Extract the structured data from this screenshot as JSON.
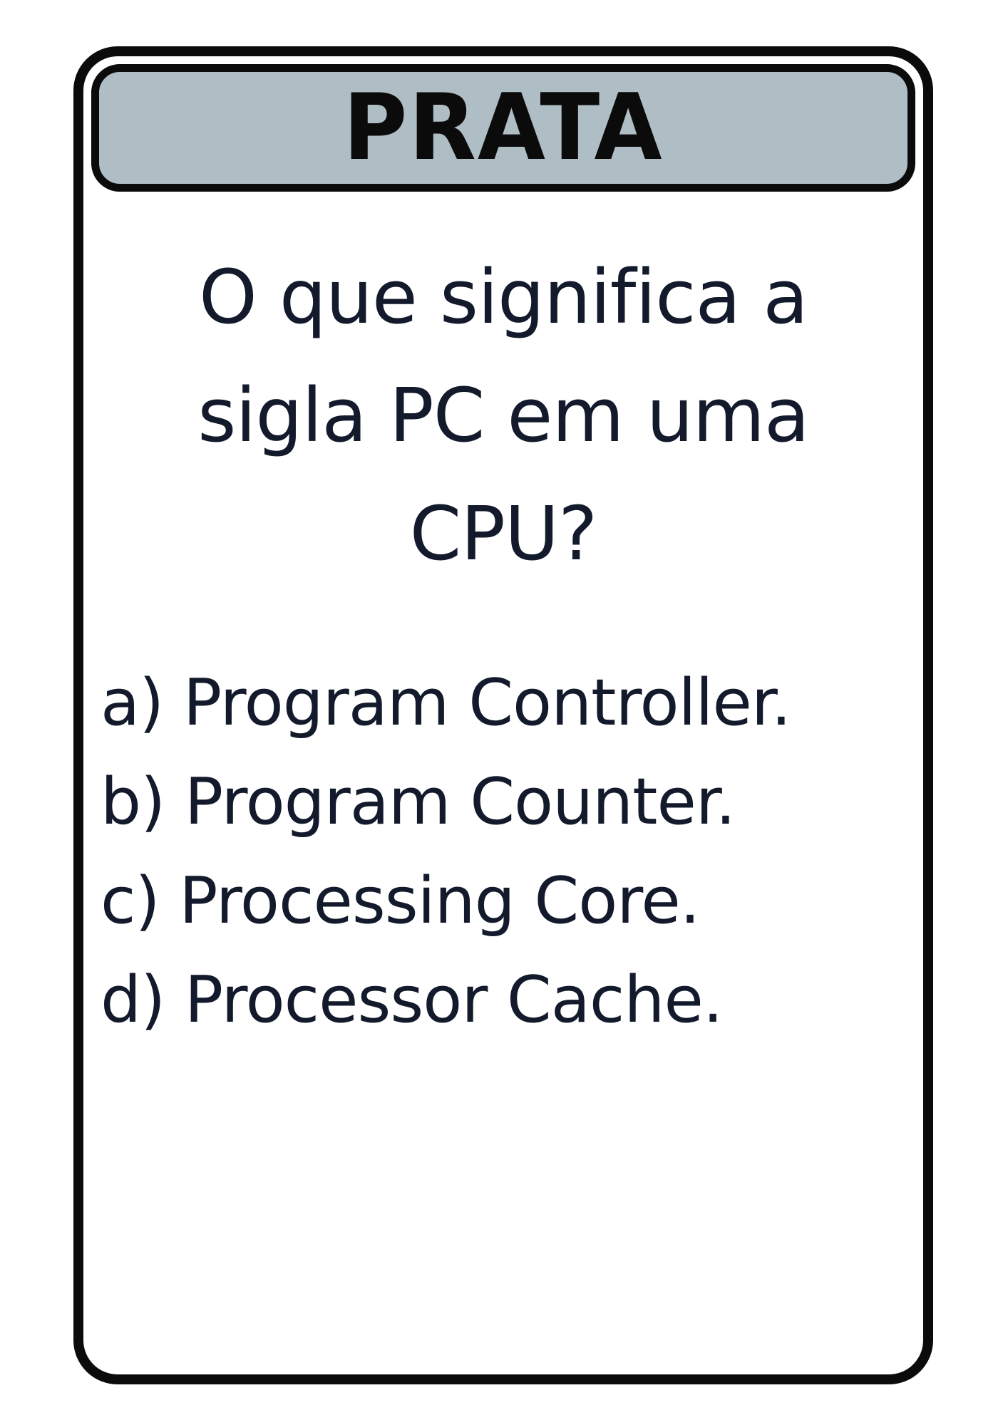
{
  "card": {
    "header_title": "PRATA",
    "header_color": "#afbec5",
    "question_lines": [
      "O que significa a",
      "sigla PC em uma",
      "CPU?"
    ],
    "options": [
      "a) Program Controller.",
      "b) Program Counter.",
      "c) Processing Core.",
      "d) Processor Cache."
    ]
  }
}
